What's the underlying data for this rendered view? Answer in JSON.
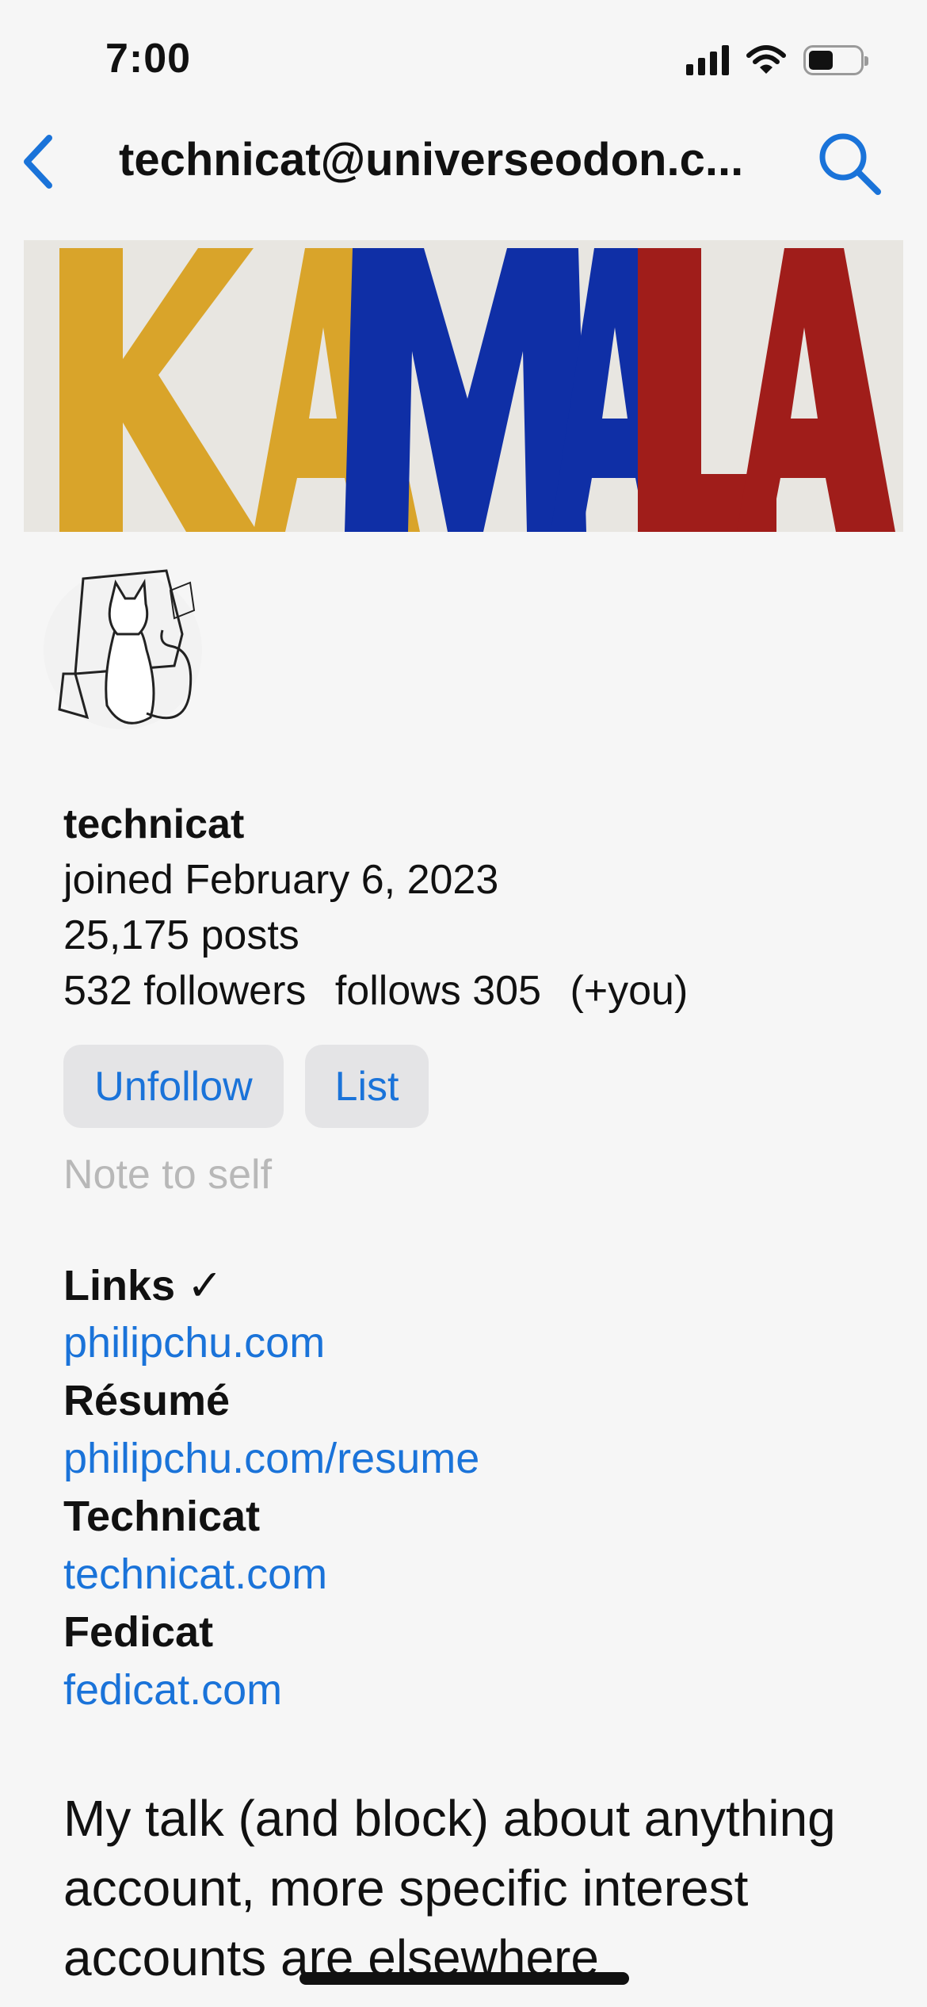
{
  "status_bar": {
    "time": "7:00",
    "icons": [
      "signal-icon",
      "wifi-icon",
      "battery-icon"
    ]
  },
  "nav": {
    "title": "technicat@universeodon.c...",
    "back_icon": "chevron-left-icon",
    "search_icon": "search-icon"
  },
  "banner": {
    "text": "KAMALA",
    "letters": [
      "K",
      "A",
      "M",
      "A",
      "L",
      "A"
    ],
    "colors": [
      "#d9a42a",
      "#d9a42a",
      "#0f2fa6",
      "#0f2fa6",
      "#a01d1a",
      "#a01d1a"
    ]
  },
  "profile": {
    "name": "technicat",
    "joined": "joined February 6, 2023",
    "posts": "25,175 posts",
    "followers": "532 followers",
    "follows": "follows 305",
    "you": "(+you)"
  },
  "actions": {
    "unfollow_label": "Unfollow",
    "list_label": "List",
    "note_placeholder": "Note to self"
  },
  "fields": [
    {
      "label": "Links ✓",
      "value": "philipchu.com"
    },
    {
      "label": "Résumé",
      "value": "philipchu.com/resume"
    },
    {
      "label": "Technicat",
      "value": "technicat.com"
    },
    {
      "label": "Fedicat",
      "value": "fedicat.com"
    }
  ],
  "bio": "My talk (and block) about anything account, more specific interest accounts are elsewhere",
  "colors": {
    "accent": "#1a73d9",
    "background": "#f6f6f6",
    "button_bg": "#e4e4e6",
    "muted_text": "#b8b8b8"
  }
}
